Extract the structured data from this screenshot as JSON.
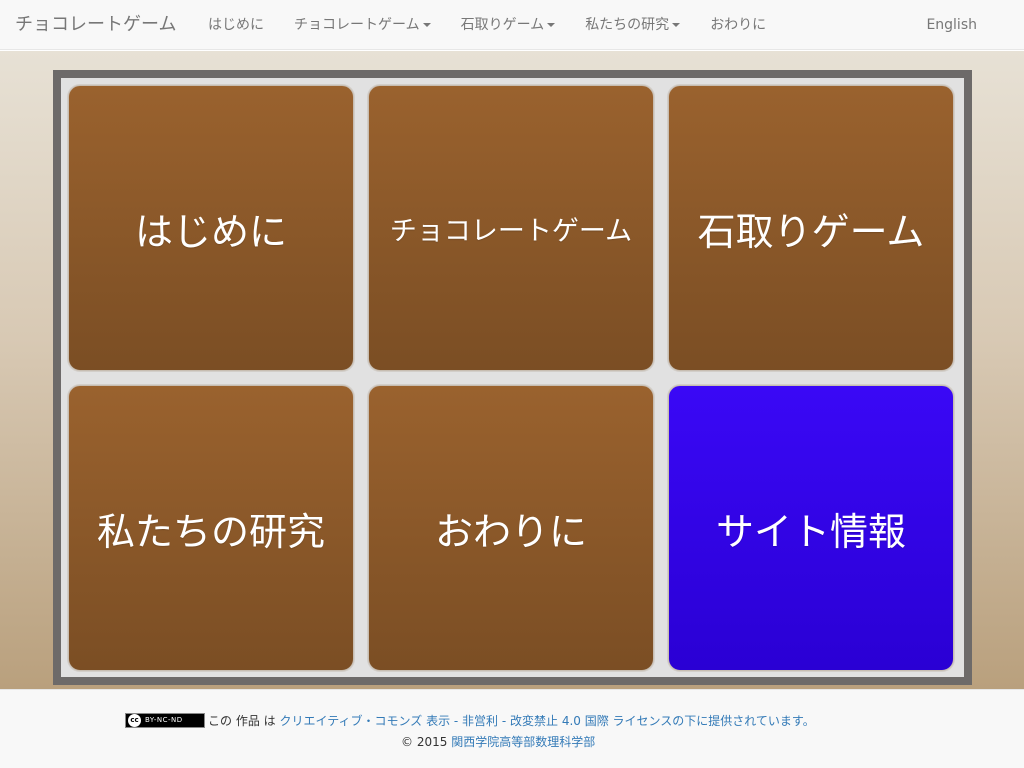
{
  "navbar": {
    "brand": "チョコレートゲーム",
    "items": [
      {
        "label": "はじめに",
        "dropdown": false
      },
      {
        "label": "チョコレートゲーム",
        "dropdown": true
      },
      {
        "label": "石取りゲーム",
        "dropdown": true
      },
      {
        "label": "私たちの研究",
        "dropdown": true
      },
      {
        "label": "おわりに",
        "dropdown": false
      }
    ],
    "language": "English"
  },
  "tiles": [
    {
      "label": "はじめに",
      "color": "#8b5a2b"
    },
    {
      "label": "チョコレートゲーム",
      "color": "#8b5a2b"
    },
    {
      "label": "石取りゲーム",
      "color": "#8b5a2b"
    },
    {
      "label": "私たちの研究",
      "color": "#8b5a2b"
    },
    {
      "label": "おわりに",
      "color": "#8b5a2b"
    },
    {
      "label": "サイト情報",
      "color": "#3300ee"
    }
  ],
  "footer": {
    "badge_text": "BY-NC-ND",
    "badge_cc": "cc",
    "license_prefix": "この 作品 は",
    "license_link": "クリエイティブ・コモンズ 表示 - 非営利 - 改変禁止 4.0 国際 ライセンスの下に提供されています。",
    "copyright_prefix": "© 2015",
    "copyright_org": "関西学院高等部数理科学部"
  }
}
